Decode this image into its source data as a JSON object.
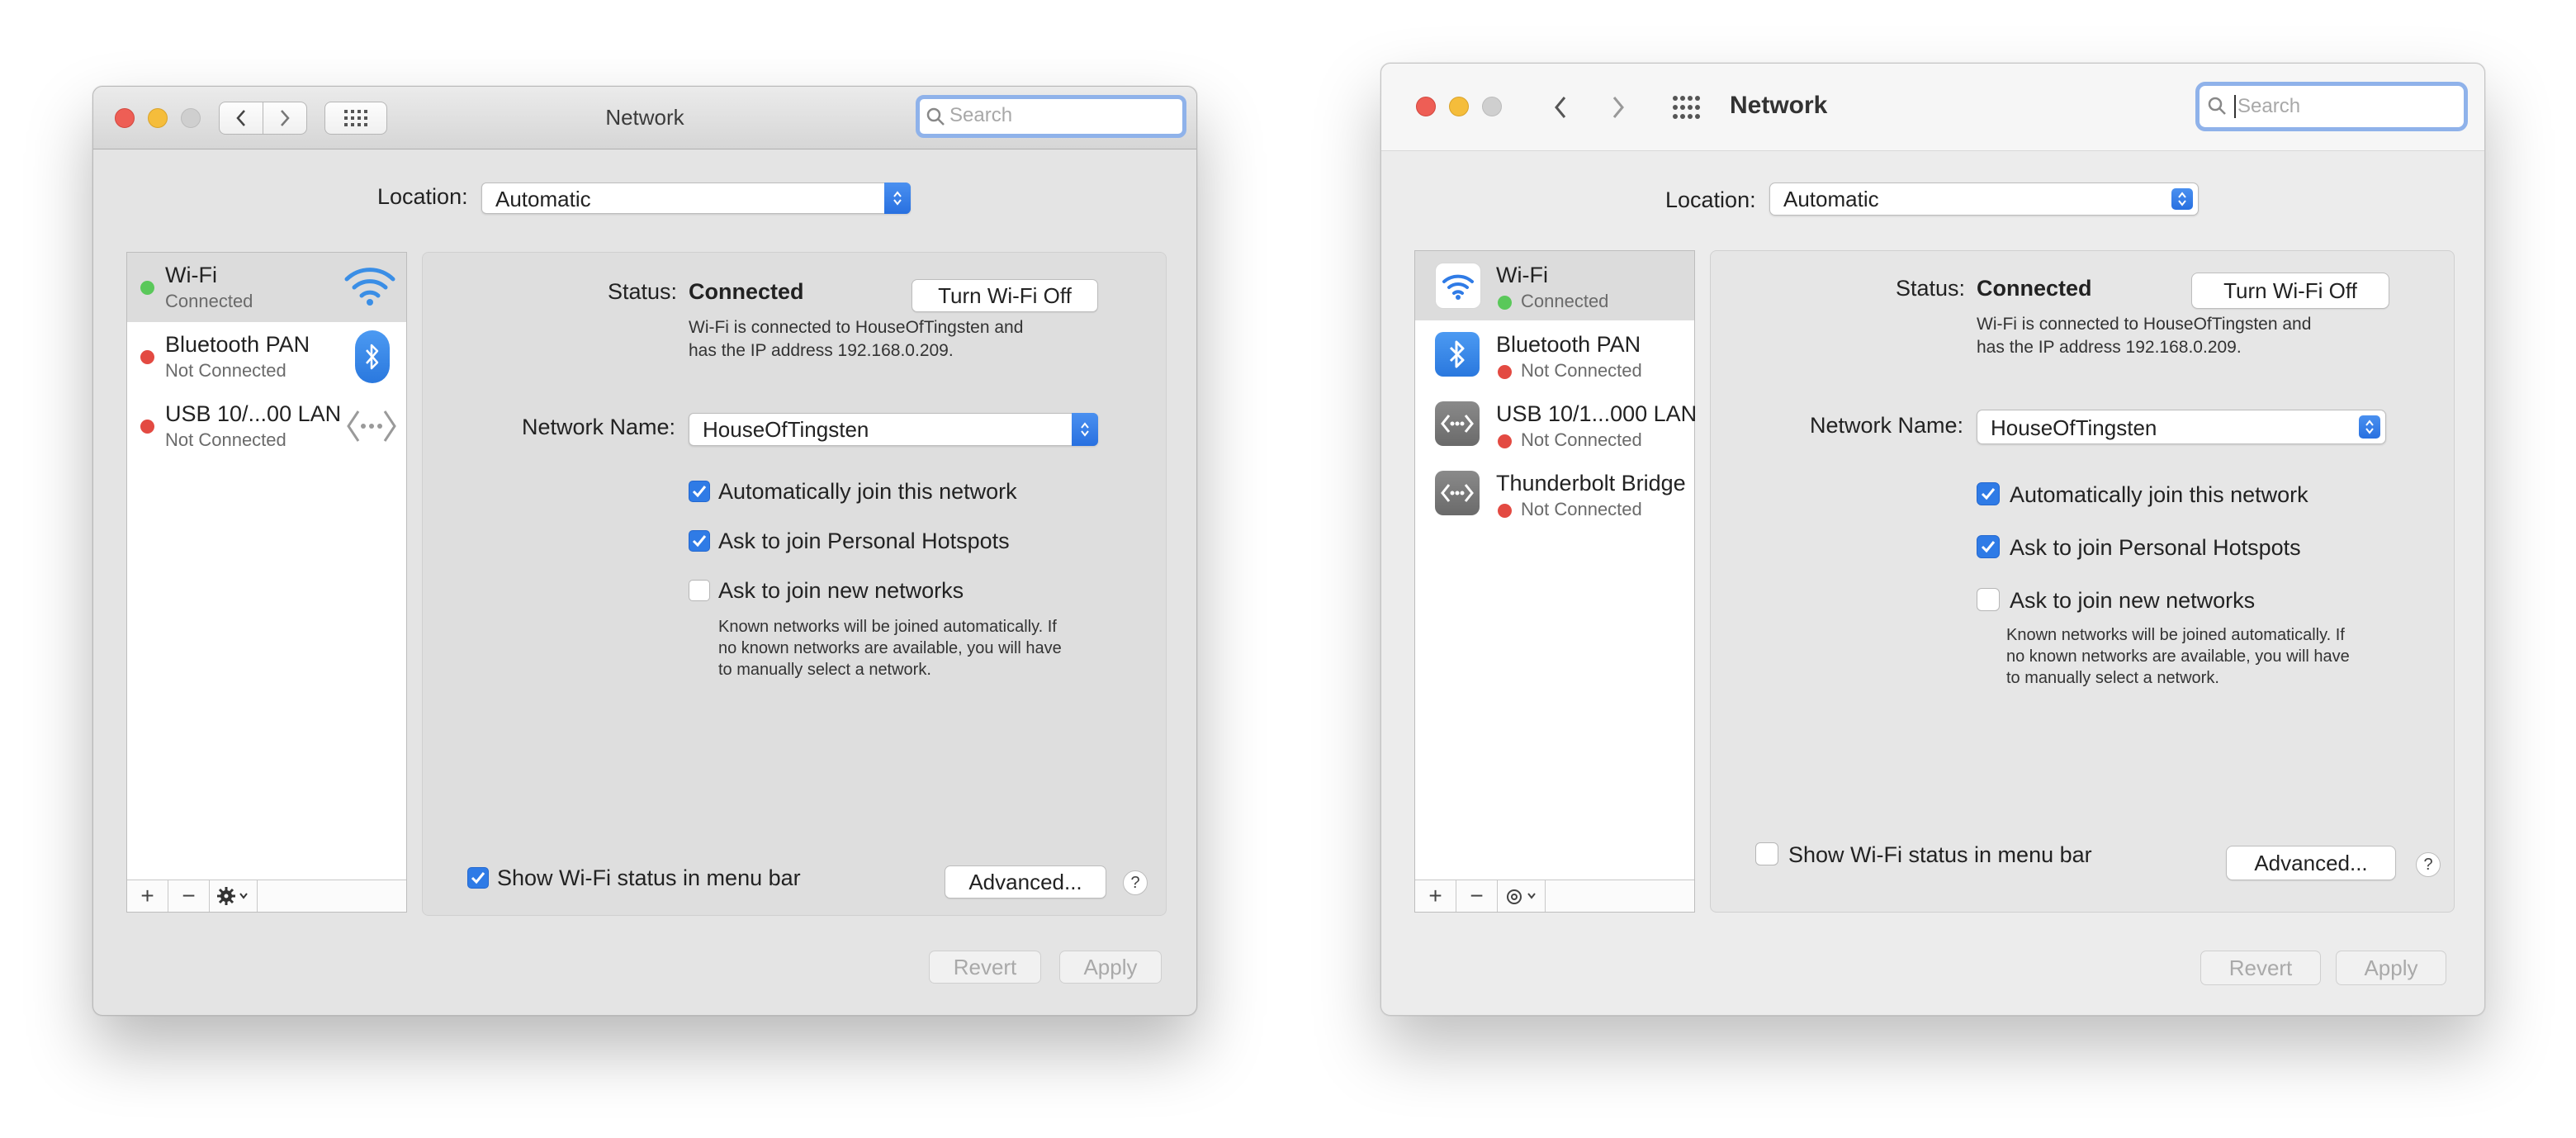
{
  "left": {
    "title": "Network",
    "search_placeholder": "Search",
    "location_label": "Location:",
    "location_value": "Automatic",
    "services": [
      {
        "name": "Wi-Fi",
        "status": "Connected"
      },
      {
        "name": "Bluetooth PAN",
        "status": "Not Connected"
      },
      {
        "name": "USB 10/...00 LAN",
        "status": "Not Connected"
      }
    ],
    "status_label": "Status:",
    "status_value": "Connected",
    "turn_off_label": "Turn Wi-Fi Off",
    "status_desc_1": "Wi-Fi is connected to HouseOfTingsten and",
    "status_desc_2": "has the IP address 192.168.0.209.",
    "network_name_label": "Network Name:",
    "network_name_value": "HouseOfTingsten",
    "auto_join": "Automatically join this network",
    "personal_hotspots": "Ask to join Personal Hotspots",
    "new_networks": "Ask to join new networks",
    "known_1": "Known networks will be joined automatically. If",
    "known_2": "no known networks are available, you will have",
    "known_3": "to manually select a network.",
    "show_status": "Show Wi-Fi status in menu bar",
    "advanced": "Advanced...",
    "help": "?",
    "revert": "Revert",
    "apply": "Apply"
  },
  "right": {
    "title": "Network",
    "search_placeholder": "Search",
    "location_label": "Location:",
    "location_value": "Automatic",
    "services": [
      {
        "name": "Wi-Fi",
        "status": "Connected"
      },
      {
        "name": "Bluetooth PAN",
        "status": "Not Connected"
      },
      {
        "name": "USB 10/1...000 LAN",
        "status": "Not Connected"
      },
      {
        "name": "Thunderbolt Bridge",
        "status": "Not Connected"
      }
    ],
    "status_label": "Status:",
    "status_value": "Connected",
    "turn_off_label": "Turn Wi-Fi Off",
    "status_desc_1": "Wi-Fi is connected to HouseOfTingsten and",
    "status_desc_2": "has the IP address 192.168.0.209.",
    "network_name_label": "Network Name:",
    "network_name_value": "HouseOfTingsten",
    "auto_join": "Automatically join this network",
    "personal_hotspots": "Ask to join Personal Hotspots",
    "new_networks": "Ask to join new networks",
    "known_1": "Known networks will be joined automatically. If",
    "known_2": "no known networks are available, you will have",
    "known_3": "to manually select a network.",
    "show_status": "Show Wi-Fi status in menu bar",
    "advanced": "Advanced...",
    "help": "?",
    "revert": "Revert",
    "apply": "Apply"
  },
  "colors": {
    "accent": "#2f7be6",
    "connected": "#5ac85a",
    "not_connected": "#e34a42"
  }
}
